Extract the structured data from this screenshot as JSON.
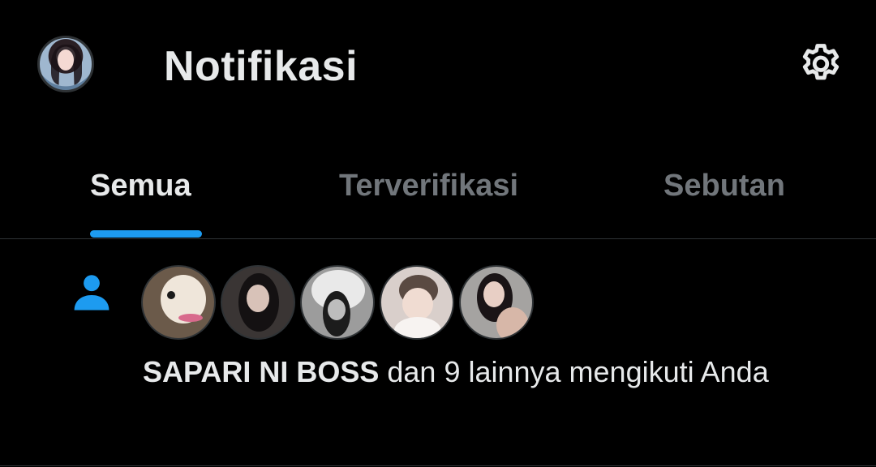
{
  "header": {
    "title": "Notifikasi",
    "avatar_icon": "profile-avatar",
    "settings_icon": "gear-icon"
  },
  "tabs": [
    {
      "label": "Semua",
      "active": true
    },
    {
      "label": "Terverifikasi",
      "active": false
    },
    {
      "label": "Sebutan",
      "active": false
    }
  ],
  "notification": {
    "type_icon": "person-icon",
    "follower_avatars": [
      "avatar-1",
      "avatar-2",
      "avatar-3",
      "avatar-4",
      "avatar-5"
    ],
    "actor": "SAPARI NI BOSS",
    "message": " dan 9 lainnya mengikuti Anda"
  },
  "colors": {
    "background": "#000000",
    "text_primary": "#e7e9ea",
    "text_secondary": "#71767b",
    "accent": "#1d9bf0",
    "divider": "#2f3336"
  }
}
